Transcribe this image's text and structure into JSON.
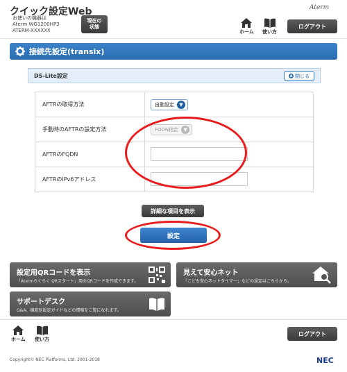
{
  "header": {
    "app_title": "クイック設定Web",
    "device_label": "お使いの機器は",
    "device_model": "Aterm WG1200HP3",
    "device_id": "ATERM-XXXXXX",
    "status_button": "現在の\n状態",
    "brand": "Aterm",
    "home_label": "ホーム",
    "help_label": "使い方",
    "logout_label": "ログアウト"
  },
  "page": {
    "title": "接続先設定(transix)"
  },
  "section": {
    "title": "DS-Lite設定",
    "collapse_label": "閉じる"
  },
  "form": {
    "rows": [
      {
        "label": "AFTRの取得方法",
        "type": "select",
        "value": "自動設定",
        "disabled": false
      },
      {
        "label": "手動時のAFTRの設定方法",
        "type": "select",
        "value": "FQDN指定",
        "disabled": true
      },
      {
        "label": "AFTRのFQDN",
        "type": "input",
        "value": ""
      },
      {
        "label": "AFTRのIPv6アドレス",
        "type": "input",
        "value": ""
      }
    ]
  },
  "buttons": {
    "detail": "詳細な項目を表示",
    "submit": "設定"
  },
  "cards": {
    "qr": {
      "title": "設定用QRコードを表示",
      "desc": "「Atermらくらく QRスタート」用のQRコードを作成できます。"
    },
    "safe": {
      "title": "見えて安心ネット",
      "desc": "「こども安心ネットタイマー」などの設定はこちらから。"
    },
    "support": {
      "title": "サポートデスク",
      "desc": "Q&A、機能別設定ガイドなどの情報をご覧になれます。"
    }
  },
  "footer": {
    "home_label": "ホーム",
    "help_label": "使い方",
    "logout_label": "ログアウト",
    "copyright": "Copyright© NEC Platforms, Ltd. 2001-2018",
    "logo": "NEC"
  },
  "colors": {
    "accent": "#2c6db0",
    "annotation": "#e81c1c"
  }
}
